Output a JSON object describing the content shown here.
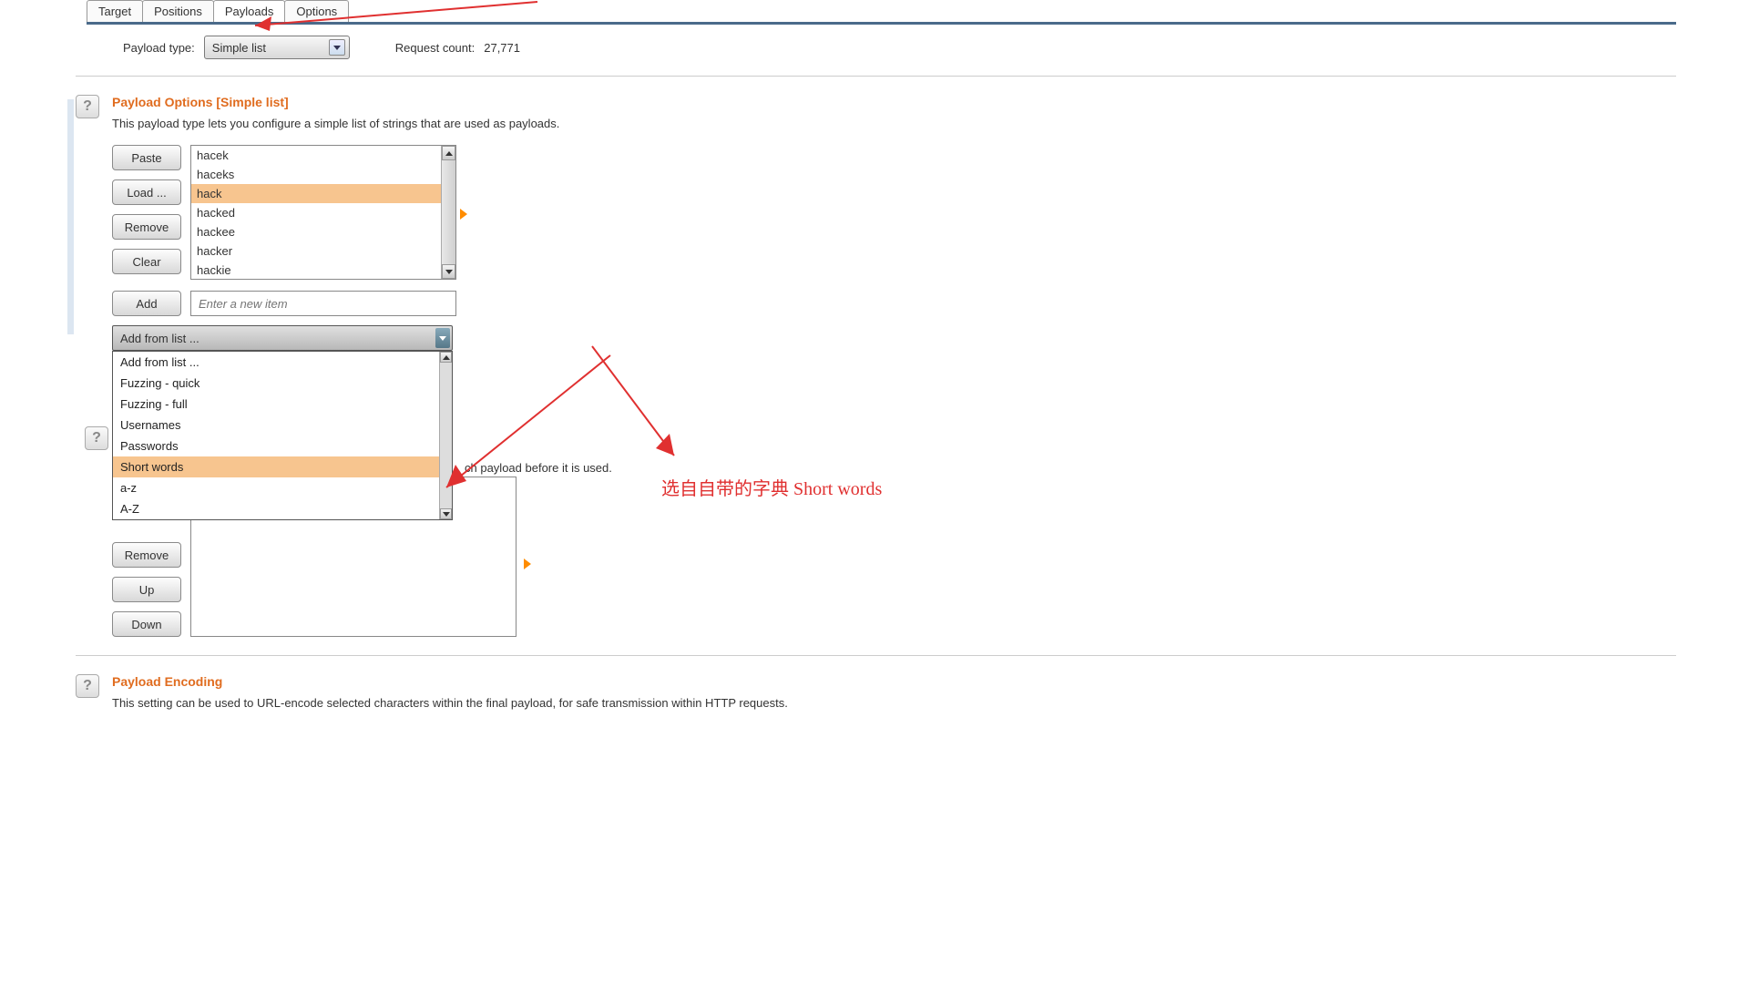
{
  "tabs": [
    "Target",
    "Positions",
    "Payloads",
    "Options"
  ],
  "active_tab": 2,
  "payload_type_label": "Payload type:",
  "payload_type_value": "Simple list",
  "request_count_label": "Request count:",
  "request_count_value": "27,771",
  "section1": {
    "title": "Payload Options [Simple list]",
    "desc": "This payload type lets you configure a simple list of strings that are used as payloads.",
    "buttons": {
      "paste": "Paste",
      "load": "Load ...",
      "remove": "Remove",
      "clear": "Clear",
      "add": "Add"
    },
    "items": [
      "hacek",
      "haceks",
      "hack",
      "hacked",
      "hackee",
      "hacker",
      "hackie"
    ],
    "selected_index": 2,
    "add_placeholder": "Enter a new item",
    "add_from_list_label": "Add from list ...",
    "dropdown": {
      "items": [
        "Add from list ...",
        "Fuzzing - quick",
        "Fuzzing - full",
        "Usernames",
        "Passwords",
        "Short words",
        "a-z",
        "A-Z"
      ],
      "highlight_index": 5
    }
  },
  "section2": {
    "desc_partial": "ch payload before it is used.",
    "buttons": {
      "remove": "Remove",
      "up": "Up",
      "down": "Down"
    }
  },
  "section3": {
    "title": "Payload Encoding",
    "desc": "This setting can be used to URL-encode selected characters within the final payload, for safe transmission within HTTP requests."
  },
  "annotation": "选自自带的字典 Short words"
}
